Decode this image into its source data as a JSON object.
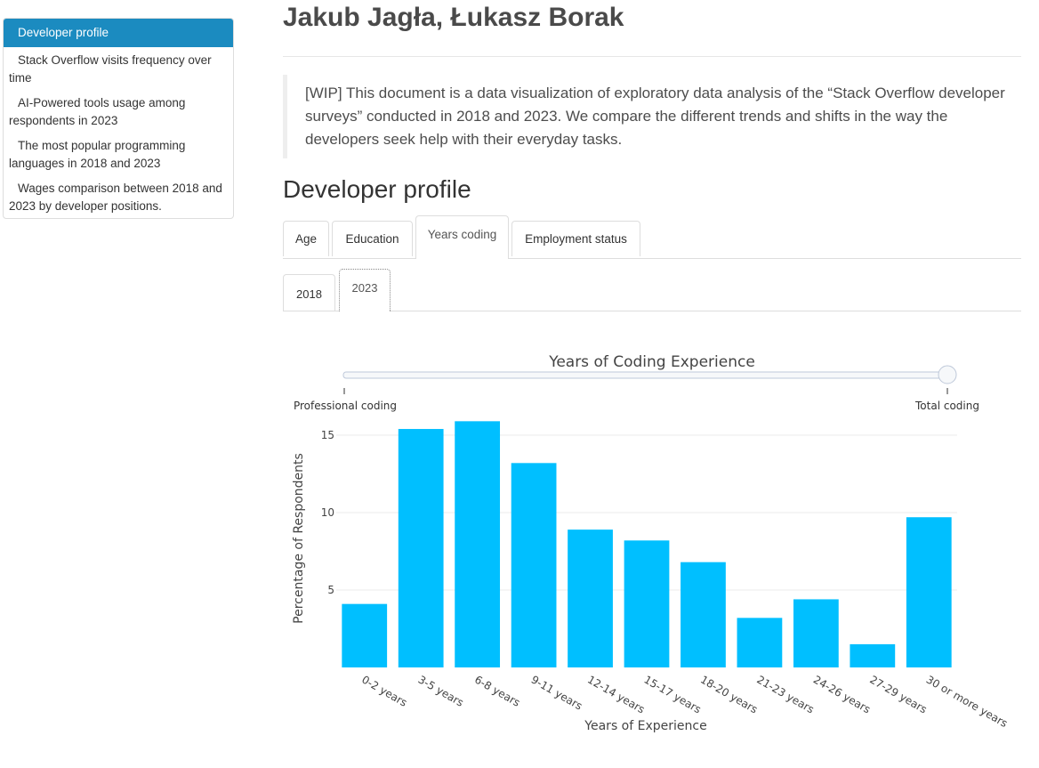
{
  "toc": {
    "items": [
      {
        "label": "Developer profile"
      },
      {
        "label": "Stack Overflow visits frequency over time"
      },
      {
        "label": "AI-Powered tools usage among respondents in 2023"
      },
      {
        "label": "The most popular programming languages in 2018 and 2023"
      },
      {
        "label": "Wages comparison between 2018 and 2023 by developer positions."
      }
    ]
  },
  "header": {
    "authors": "Jakub Jagła, Łukasz Borak",
    "intro": "[WIP] This document is a data visualization of exploratory data analysis of the “Stack Overflow developer surveys” conducted in 2018 and 2023. We compare the different trends and shifts in the way the developers seek help with their everyday tasks."
  },
  "section": {
    "title": "Developer profile"
  },
  "tabs": [
    {
      "label": "Age"
    },
    {
      "label": "Education"
    },
    {
      "label": "Years coding"
    },
    {
      "label": "Employment status"
    }
  ],
  "year_tabs": [
    {
      "label": "2018"
    },
    {
      "label": "2023"
    }
  ],
  "slider": {
    "title": "Years of Coding Experience",
    "options": [
      "Professional coding",
      "Total coding"
    ],
    "selected": "Total coding"
  },
  "colors": {
    "bar": "#00bfff",
    "toc_active": "#1b8bc0"
  },
  "chart_data": {
    "type": "bar",
    "categories": [
      "0-2 years",
      "3-5 years",
      "6-8 years",
      "9-11 years",
      "12-14 years",
      "15-17 years",
      "18-20 years",
      "21-23 years",
      "24-26 years",
      "27-29 years",
      "30 or more years"
    ],
    "values": [
      4.1,
      15.4,
      15.9,
      13.2,
      8.9,
      8.2,
      6.8,
      3.2,
      4.4,
      1.5,
      9.7
    ],
    "xlabel": "Years of Experience",
    "ylabel": "Percentage of Respondents",
    "yticks": [
      5,
      10,
      15
    ],
    "ylim": [
      0,
      16.5
    ],
    "grid": true
  }
}
